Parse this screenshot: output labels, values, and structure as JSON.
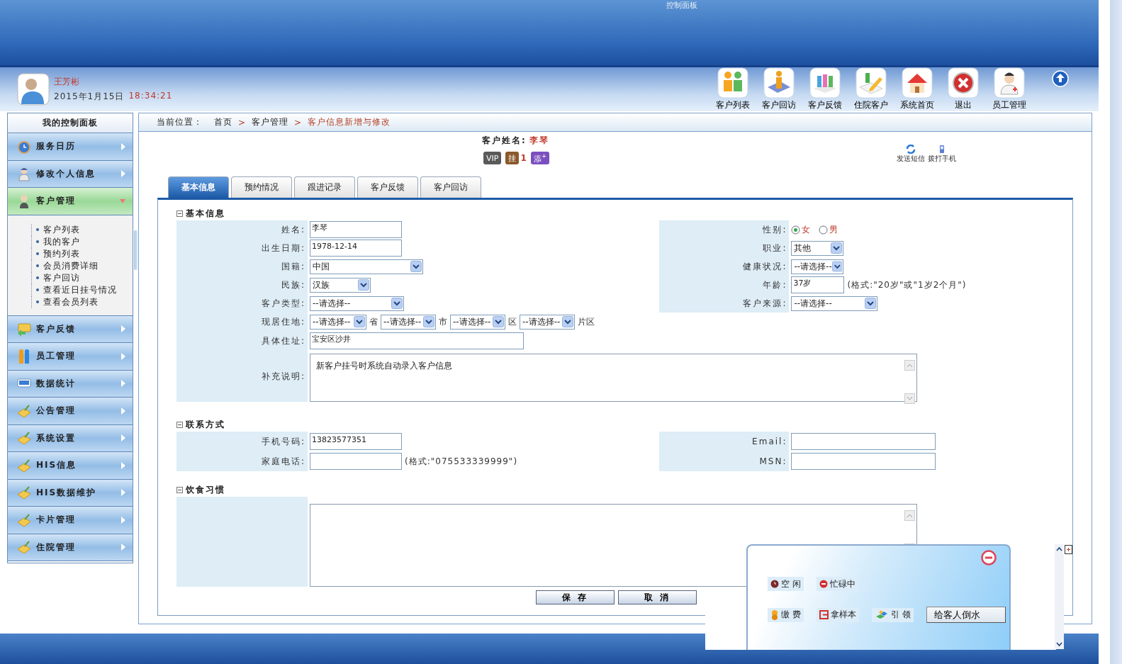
{
  "window": {
    "title": "控制面板"
  },
  "user": {
    "name": "王芳彬",
    "date": "2015年1月15日",
    "time": "18:34:21"
  },
  "toolbar": [
    {
      "label": "客户列表"
    },
    {
      "label": "客户回访"
    },
    {
      "label": "客户反馈"
    },
    {
      "label": "住院客户"
    },
    {
      "label": "系统首页"
    },
    {
      "label": "退出"
    },
    {
      "label": "员工管理"
    }
  ],
  "sidebar": {
    "title": "我的控制面板",
    "items": [
      {
        "label": "服务日历",
        "expanded": false
      },
      {
        "label": "修改个人信息",
        "expanded": false
      },
      {
        "label": "客户管理",
        "expanded": true,
        "children": [
          {
            "label": "客户列表"
          },
          {
            "label": "我的客户"
          },
          {
            "label": "预约列表"
          },
          {
            "label": "会员消费详细"
          },
          {
            "label": "客户回访"
          },
          {
            "label": "查看近日挂号情况"
          },
          {
            "label": "查看会员列表"
          }
        ]
      },
      {
        "label": "客户反馈",
        "expanded": false
      },
      {
        "label": "员工管理",
        "expanded": false
      },
      {
        "label": "数据统计",
        "expanded": false
      },
      {
        "label": "公告管理",
        "expanded": false
      },
      {
        "label": "系统设置",
        "expanded": false
      },
      {
        "label": "HIS信息",
        "expanded": false
      },
      {
        "label": "HIS数据维护",
        "expanded": false
      },
      {
        "label": "卡片管理",
        "expanded": false
      },
      {
        "label": "住院管理",
        "expanded": false
      }
    ]
  },
  "breadcrumb": {
    "label": "当前位置：",
    "separator": ">",
    "items": [
      {
        "label": "首页",
        "current": false
      },
      {
        "label": "客户管理",
        "current": false
      },
      {
        "label": "客户信息新增与修改",
        "current": true
      }
    ]
  },
  "customer": {
    "label": "客户姓名:",
    "name": "李琴",
    "badges": [
      {
        "kind": "vip",
        "text": "VIP"
      },
      {
        "kind": "register",
        "text": "挂",
        "count": "1"
      },
      {
        "kind": "add",
        "text": "添$^{+}$"
      }
    ]
  },
  "actions": [
    {
      "label": "发送短信"
    },
    {
      "label": "拨打手机"
    }
  ],
  "tabs": [
    {
      "label": "基本信息",
      "selected": true
    },
    {
      "label": "预约情况",
      "selected": false
    },
    {
      "label": "跟进记录",
      "selected": false
    },
    {
      "label": "客户反馈",
      "selected": false
    },
    {
      "label": "客户回访",
      "selected": false
    }
  ],
  "basic_info": {
    "title": "基本信息",
    "left": [
      {
        "label": "姓名:",
        "kind": "text",
        "value": "李琴"
      },
      {
        "label": "出生日期:",
        "kind": "text",
        "value": "1978-12-14"
      },
      {
        "label": "国籍:",
        "kind": "select",
        "value": "中国"
      },
      {
        "label": "民族:",
        "kind": "select",
        "value": "汉族"
      },
      {
        "label": "客户类型:",
        "kind": "select",
        "value": "--请选择--"
      },
      {
        "label": "现居住地:",
        "kind": "address",
        "parts": [
          {
            "value": "--请选择--",
            "unit": "省"
          },
          {
            "value": "--请选择--",
            "unit": "市"
          },
          {
            "value": "--请选择--",
            "unit": "区"
          },
          {
            "value": "--请选择--",
            "unit": "片区"
          }
        ]
      }
    ],
    "right": [
      {
        "label": "性别:",
        "kind": "radio",
        "options": [
          {
            "label": "女",
            "selected": true
          },
          {
            "label": "男",
            "selected": false
          }
        ]
      },
      {
        "label": "职业:",
        "kind": "select",
        "value": "其他"
      },
      {
        "label": "健康状况:",
        "kind": "select",
        "value": "--请选择--"
      },
      {
        "label": "年龄:",
        "kind": "text",
        "value": "37岁",
        "hint": "(格式:\"20岁\"或\"1岁2个月\")"
      },
      {
        "label": "客户来源:",
        "kind": "select",
        "value": "--请选择--"
      }
    ],
    "address": {
      "label": "具体住址:",
      "value": "宝安区沙井"
    },
    "remarks": {
      "label": "补充说明:",
      "value": "新客户挂号时系统自动录入客户信息"
    }
  },
  "contact": {
    "title": "联系方式",
    "left": [
      {
        "label": "手机号码:",
        "kind": "text",
        "value": "13823577351"
      },
      {
        "label": "家庭电话:",
        "kind": "text",
        "hint": "(格式:\"075533339999\")"
      }
    ],
    "right": [
      {
        "label": "Email:",
        "kind": "text"
      },
      {
        "label": "MSN:",
        "kind": "text"
      }
    ]
  },
  "diet": {
    "title": "饮食习惯"
  },
  "buttons": [
    {
      "label": "保 存"
    },
    {
      "label": "取 消"
    }
  ],
  "popup": {
    "status": [
      {
        "label": "空 闲"
      },
      {
        "label": "忙碌中"
      }
    ],
    "tasks": [
      {
        "label": "缴 费"
      },
      {
        "label": "拿样本"
      },
      {
        "label": "引 领"
      }
    ],
    "button": "给客人倒水"
  }
}
